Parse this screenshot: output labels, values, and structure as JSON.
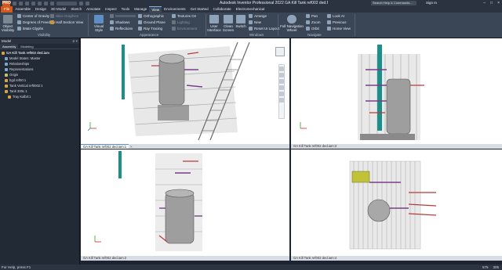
{
  "app": {
    "title": "Autodesk Inventor Professional 2022   GA Kill Tank ref002 ded.f",
    "logo": "PRO",
    "search_placeholder": "Search Help & Commands...",
    "sign_in": "Sign In"
  },
  "tabs": [
    "File",
    "Assemble",
    "Design",
    "3D Model",
    "Sketch",
    "Annotate",
    "Inspect",
    "Tools",
    "Manage",
    "View",
    "Environments",
    "Get Started",
    "Collaborate",
    "Electromechanical"
  ],
  "active_tab": "View",
  "ribbon": {
    "visibility": {
      "label": "Visibility",
      "object_visibility": "Object Visibility",
      "items": [
        "Center of Gravity",
        "Degrees of Freedom",
        "iMate Glyphs"
      ],
      "items2": [
        "Slice Graphics",
        "Half Section View"
      ]
    },
    "appearance": {
      "label": "Appearance",
      "visual_style": "Visual Style",
      "items": [
        "Shadows",
        "Reflections"
      ],
      "items2": [
        "Orthographic",
        "Ground Plane",
        "Ray Tracing"
      ],
      "items3": [
        "Textures On",
        "Lighting",
        "Environment"
      ]
    },
    "windows": {
      "label": "Windows",
      "user_interface": "User Interface",
      "clean_screen": "Clean Screen",
      "switch": "Switch",
      "items": [
        "Arrange",
        "New",
        "Reset UI Layout"
      ],
      "full_nav": "Full Navigation Wheel"
    },
    "navigate": {
      "label": "Navigate",
      "items": [
        "Pan",
        "Zoom",
        "Orbit"
      ],
      "items2": [
        "Look At",
        "Previous",
        "Home View"
      ]
    }
  },
  "browser": {
    "title": "Model",
    "tabs": [
      "Assembly",
      "Modeling"
    ],
    "tree": [
      "GA Kill Tank ref002 ded.iam",
      "Model States: Master",
      "Relationships",
      "Representations",
      "Origin",
      "bgd ref00:1",
      "Tank Vertical ref0002:1",
      "Tank 300L:1",
      "Tray Kalbit:1"
    ]
  },
  "viewports": [
    {
      "name": "GA Kill Tank ref002 ded.iam:1"
    },
    {
      "name": "GA Kill Tank ref002 ded.iam:3"
    },
    {
      "name": "GA Kill Tank ref002 ded.iam:2"
    },
    {
      "name": "GA Kill Tank ref002 ded.iam:4"
    }
  ],
  "status": {
    "left": "For Help, press F1",
    "right": [
      "575",
      "305"
    ]
  },
  "colors": {
    "accent": "#d35a1c",
    "background": "#1d2330",
    "ribbon": "#3a4656",
    "viewport": "#ffffff"
  }
}
